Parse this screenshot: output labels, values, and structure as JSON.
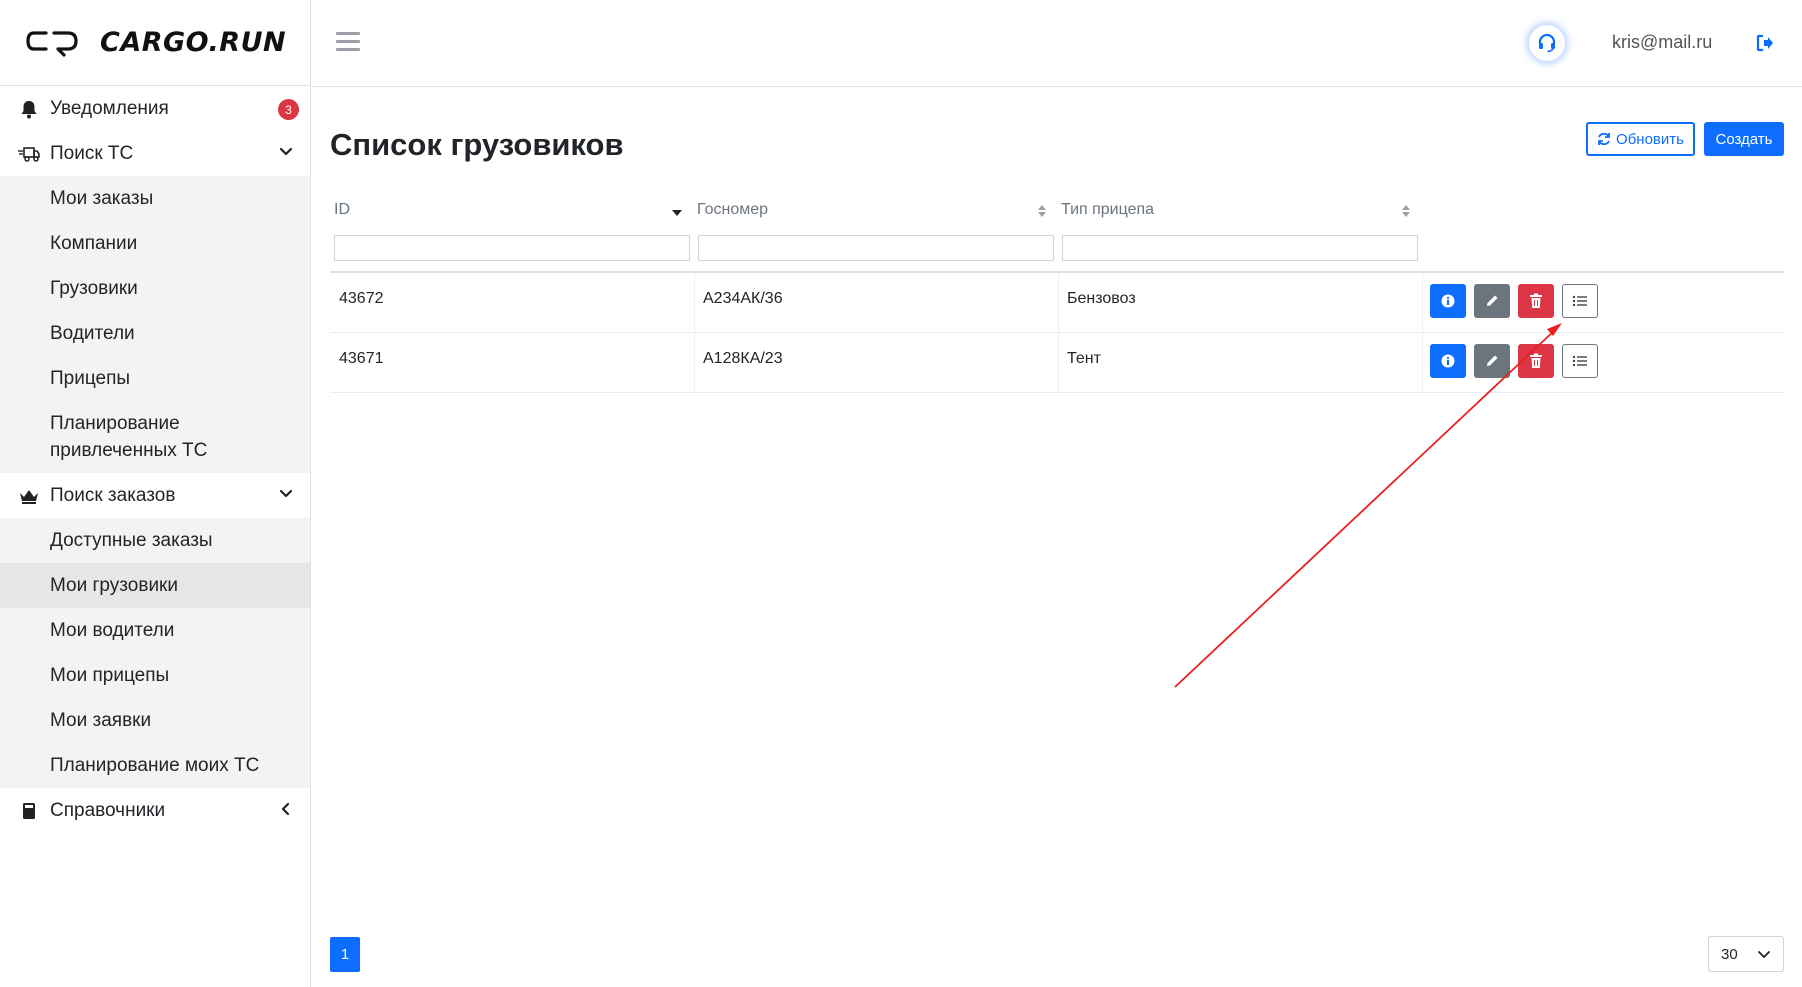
{
  "brand": {
    "name": "CARGO.RUN"
  },
  "topbar": {
    "user_email": "kris@mail.ru",
    "icons": [
      "hamburger-icon",
      "headset-icon",
      "logout-icon"
    ]
  },
  "sidebar": {
    "notifications": {
      "label": "Уведомления",
      "count": "3"
    },
    "search_vehicles": {
      "label": "Поиск ТС",
      "items": [
        "Мои заказы",
        "Компании",
        "Грузовики",
        "Водители",
        "Прицепы",
        "Планирование привлеченных ТС"
      ]
    },
    "search_orders": {
      "label": "Поиск заказов",
      "items": [
        "Доступные заказы",
        "Мои грузовики",
        "Мои водители",
        "Мои прицепы",
        "Мои заявки",
        "Планирование моих ТС"
      ],
      "active_index": 1
    },
    "directories": {
      "label": "Справочники"
    }
  },
  "main": {
    "title": "Список грузовиков",
    "refresh_label": "Обновить",
    "create_label": "Создать"
  },
  "table": {
    "columns": [
      "ID",
      "Госномер",
      "Тип прицепа"
    ],
    "rows": [
      {
        "id": "43672",
        "plate": "А234АК/36",
        "trailer_type": "Бензовоз"
      },
      {
        "id": "43671",
        "plate": "А128КА/23",
        "trailer_type": "Тент"
      }
    ],
    "row_action_icons": [
      "info-icon",
      "pencil-icon",
      "trash-icon",
      "list-icon"
    ]
  },
  "pagination": {
    "current_page": "1",
    "page_size": "30"
  },
  "colors": {
    "primary": "#0d6efd",
    "danger": "#dc3545",
    "secondary": "#6c757d",
    "annotation_arrow": "#e8201f"
  }
}
